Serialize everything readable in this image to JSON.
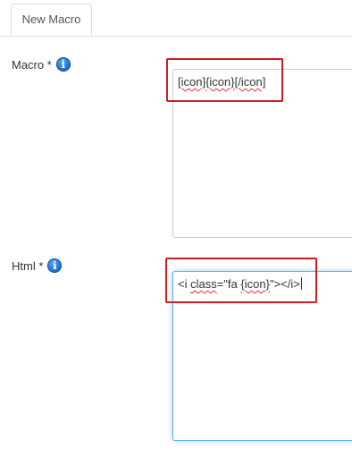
{
  "tabs": [
    {
      "label": "New Macro",
      "active": true
    }
  ],
  "form": {
    "macro": {
      "label": "Macro *",
      "info_icon": "info-icon",
      "value_parts": [
        "[icon]",
        "{icon}",
        "[/icon]"
      ]
    },
    "html": {
      "label": "Html *",
      "info_icon": "info-icon",
      "value_parts": [
        "<i ",
        "class",
        "=\"fa ",
        "{icon}",
        "\"></i>"
      ],
      "focused": true
    }
  },
  "colors": {
    "highlight": "#cc1f1f",
    "focus_border": "#66afe9",
    "info_icon": "#1d72d1"
  }
}
